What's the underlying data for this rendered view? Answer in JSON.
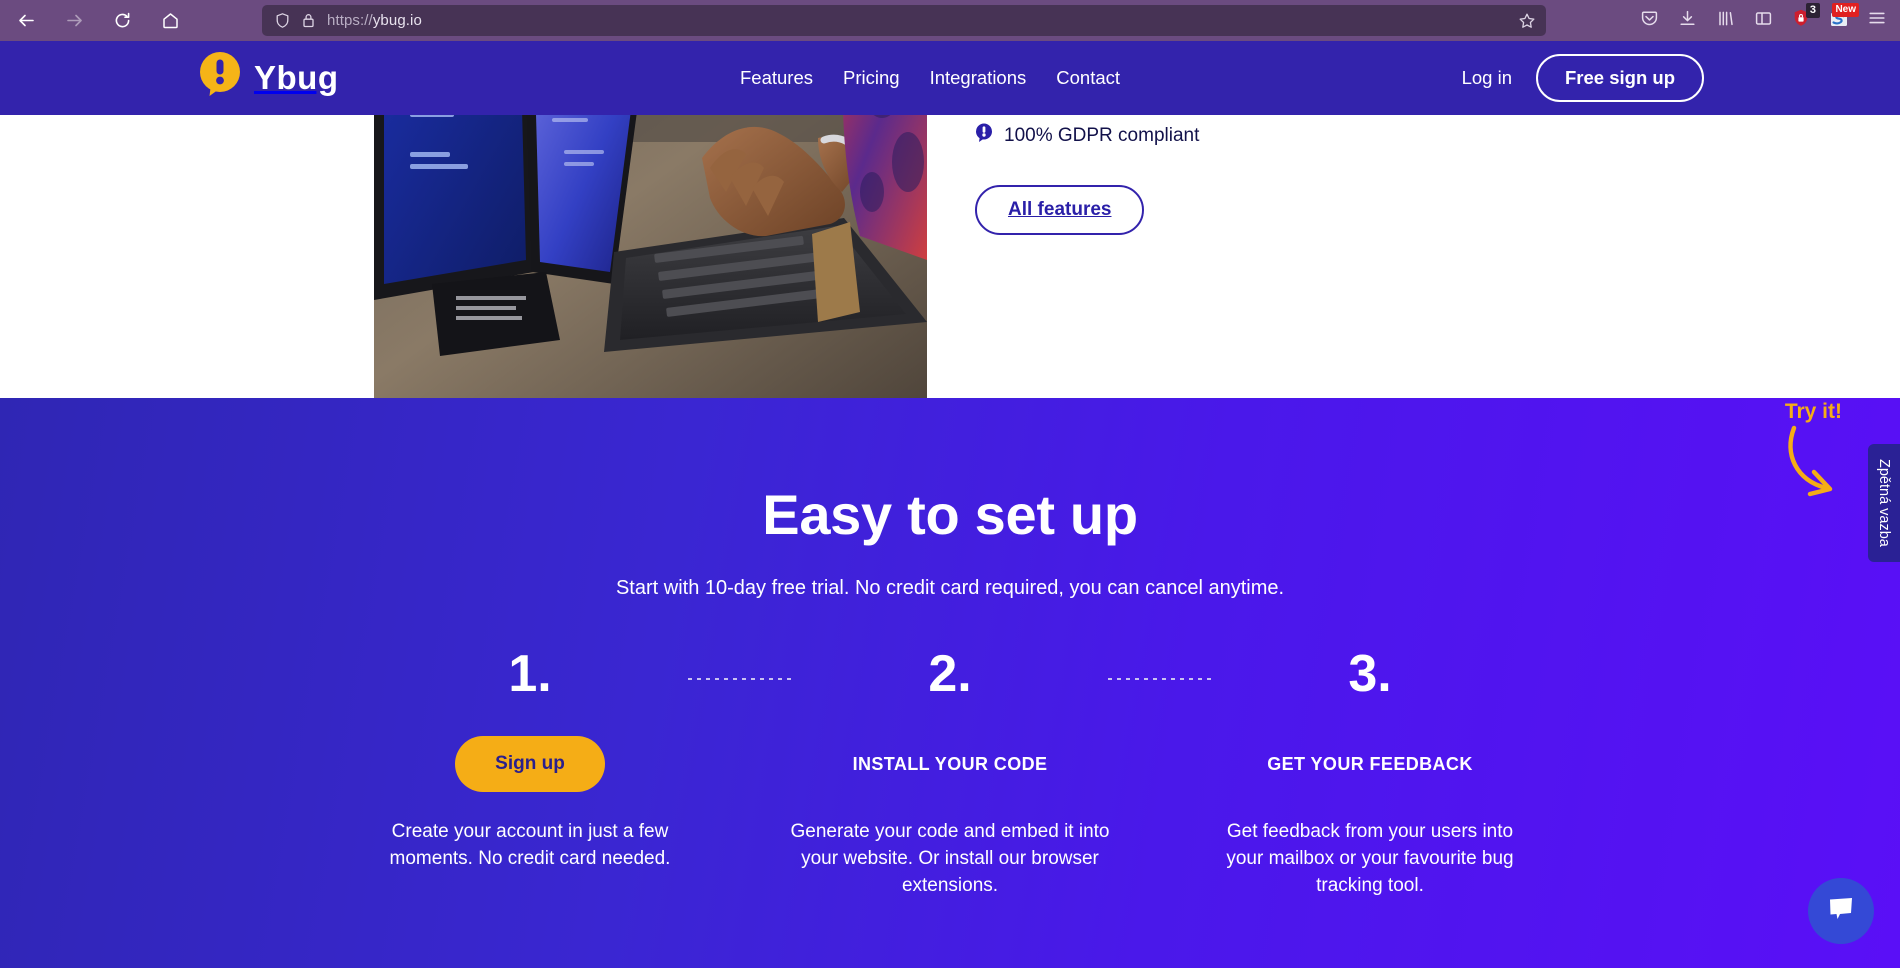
{
  "browser": {
    "back_icon": "back-arrow-icon",
    "forward_icon": "forward-arrow-icon",
    "reload_icon": "reload-icon",
    "home_icon": "home-icon",
    "url_protocol": "https://",
    "url_host": "ybug.io",
    "url_full": "https://ybug.io",
    "shield_icon": "tracking-protection-shield-icon",
    "lock_icon": "padlock-icon",
    "bookmark_icon": "star-bookmark-icon",
    "toolbar_icons": [
      {
        "name": "pocket-icon",
        "badge": ""
      },
      {
        "name": "downloads-icon",
        "badge": ""
      },
      {
        "name": "library-icon",
        "badge": ""
      },
      {
        "name": "sidebar-icon",
        "badge": ""
      },
      {
        "name": "shield-extension-icon",
        "badge": "3"
      },
      {
        "name": "extension-icon",
        "badge": "New"
      },
      {
        "name": "hamburger-menu-icon",
        "badge": ""
      }
    ]
  },
  "site": {
    "logo_text": "Ybug",
    "logo_icon": "ybug-speech-bubble-icon",
    "nav": [
      {
        "label": "Features"
      },
      {
        "label": "Pricing"
      },
      {
        "label": "Integrations"
      },
      {
        "label": "Contact"
      }
    ],
    "login_label": "Log in",
    "signup_label": "Free sign up"
  },
  "hero": {
    "photo_alt": "person-typing-on-laptop-photo",
    "gdpr_icon": "ybug-bubble-bullet-icon",
    "gdpr_text": "100% GDPR compliant",
    "all_features_label": "All features"
  },
  "setup": {
    "title": "Easy to set up",
    "subtitle": "Start with 10-day free trial. No credit card required, you can cancel anytime.",
    "steps": [
      {
        "number": "1.",
        "cta_label": "Sign up",
        "label": "",
        "description": "Create your account in just a few moments. No credit card needed."
      },
      {
        "number": "2.",
        "cta_label": "",
        "label": "INSTALL YOUR CODE",
        "description": "Generate your code and embed it into your website. Or install our browser extensions."
      },
      {
        "number": "3.",
        "cta_label": "",
        "label": "GET YOUR FEEDBACK",
        "description": "Get feedback from your users into your mailbox or your favourite bug tracking tool."
      }
    ]
  },
  "widgets": {
    "try_it_label": "Try it!",
    "try_arrow_icon": "curved-arrow-icon",
    "feedback_tab_label": "Zpětná vazba",
    "chat_icon": "chat-bubble-icon"
  },
  "colors": {
    "brand_indigo": "#3323ac",
    "brand_violet": "#5a0ff7",
    "accent_yellow": "#f5ad16",
    "chrome_purple": "#6b4b80",
    "urlbar_purple": "#473355",
    "feedback_tab": "#2a2195",
    "chat_blue": "#3449d6"
  }
}
